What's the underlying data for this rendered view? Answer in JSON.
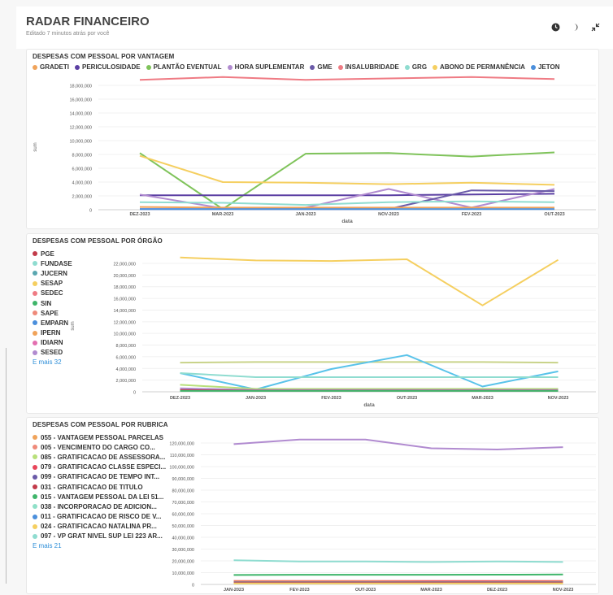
{
  "header": {
    "title": "RADAR FINANCEIRO",
    "subtitle": "Editado 7 minutos atrás por você",
    "icons": [
      "clock-icon",
      "moon-icon",
      "collapse-icon"
    ]
  },
  "charts": [
    {
      "title": "DESPESAS COM PESSOAL POR VANTAGEM",
      "more": "",
      "legend": [
        {
          "name": "GRADETI",
          "color": "#f0a35a"
        },
        {
          "name": "PERICULOSIDADE",
          "color": "#5b3fa3"
        },
        {
          "name": "PLANTÃO EVENTUAL",
          "color": "#7fc35a"
        },
        {
          "name": "HORA SUPLEMENTAR",
          "color": "#b18bd0"
        },
        {
          "name": "GME",
          "color": "#6a5aa8"
        },
        {
          "name": "INSALUBRIDADE",
          "color": "#ef7b84"
        },
        {
          "name": "GRG",
          "color": "#8fdcd0"
        },
        {
          "name": "ABONO DE PERMANÊNCIA",
          "color": "#f5cf60"
        },
        {
          "name": "JETON",
          "color": "#4b8fdc"
        }
      ],
      "chart_data": {
        "type": "line",
        "categories": [
          "DEZ-2023",
          "MAR-2023",
          "JAN-2023",
          "NOV-2023",
          "FEV-2023",
          "OUT-2023"
        ],
        "xlabel": "data",
        "ylabel": "sum",
        "ylim": [
          0,
          18000000
        ],
        "yticks": [
          "0",
          "2,000,000",
          "4,000,000",
          "6,000,000",
          "8,000,000",
          "10,000,000",
          "12,000,000",
          "14,000,000",
          "16,000,000",
          "18,000,000"
        ],
        "tick_step": 2000000,
        "series": [
          {
            "name": "INSALUBRIDADE",
            "color": "#ef7b84",
            "values": [
              18800000,
              19200000,
              18800000,
              19000000,
              19200000,
              18900000
            ]
          },
          {
            "name": "PLANTÃO EVENTUAL",
            "color": "#7fc35a",
            "values": [
              8200000,
              100000,
              8100000,
              8200000,
              7700000,
              8300000
            ]
          },
          {
            "name": "ABONO DE PERMANÊNCIA",
            "color": "#f5cf60",
            "values": [
              7800000,
              4000000,
              3900000,
              3700000,
              3900000,
              3600000
            ]
          },
          {
            "name": "PERICULOSIDADE",
            "color": "#5b3fa3",
            "values": [
              2100000,
              2100000,
              2100000,
              2100000,
              2200000,
              2300000
            ]
          },
          {
            "name": "HORA SUPLEMENTAR",
            "color": "#b18bd0",
            "values": [
              2200000,
              200000,
              300000,
              3000000,
              300000,
              3000000
            ]
          },
          {
            "name": "GME",
            "color": "#6a5aa8",
            "values": [
              100000,
              100000,
              100000,
              100000,
              2800000,
              2700000
            ]
          },
          {
            "name": "GRG",
            "color": "#8fdcd0",
            "values": [
              1100000,
              1000000,
              700000,
              1100000,
              1200000,
              1100000
            ]
          },
          {
            "name": "GRADETI",
            "color": "#f0a35a",
            "values": [
              400000,
              300000,
              300000,
              300000,
              300000,
              300000
            ]
          },
          {
            "name": "JETON",
            "color": "#4b8fdc",
            "values": [
              100000,
              100000,
              100000,
              100000,
              100000,
              100000
            ]
          }
        ]
      }
    },
    {
      "title": "DESPESAS COM PESSOAL POR ÓRGÃO",
      "more": "E mais 32",
      "legend": [
        {
          "name": "PGE",
          "color": "#c23b4a"
        },
        {
          "name": "FUNDASE",
          "color": "#8fdcd0"
        },
        {
          "name": "JUCERN",
          "color": "#5aa7b0"
        },
        {
          "name": "SESAP",
          "color": "#f5cf60"
        },
        {
          "name": "SEDEC",
          "color": "#ef7b84"
        },
        {
          "name": "SIN",
          "color": "#3fb56a"
        },
        {
          "name": "SAPE",
          "color": "#ef8a7a"
        },
        {
          "name": "EMPARN",
          "color": "#4b8fdc"
        },
        {
          "name": "IPERN",
          "color": "#f0a35a"
        },
        {
          "name": "IDIARN",
          "color": "#e36fb0"
        },
        {
          "name": "SESED",
          "color": "#b18bd0"
        }
      ],
      "chart_data": {
        "type": "line",
        "categories": [
          "DEZ-2023",
          "JAN-2023",
          "FEV-2023",
          "OUT-2023",
          "MAR-2023",
          "NOV-2023"
        ],
        "xlabel": "data",
        "ylabel": "sum",
        "ylim": [
          0,
          22000000
        ],
        "yticks": [
          "0",
          "2,000,000",
          "4,000,000",
          "6,000,000",
          "8,000,000",
          "10,000,000",
          "12,000,000",
          "14,000,000",
          "16,000,000",
          "18,000,000",
          "20,000,000",
          "22,000,000"
        ],
        "tick_step": 2000000,
        "series": [
          {
            "name": "SESAP",
            "color": "#f5cf60",
            "values": [
              23000000,
              22500000,
              22400000,
              22700000,
              14800000,
              22600000
            ]
          },
          {
            "name": "",
            "color": "#c9d38a",
            "values": [
              5000000,
              5100000,
              5100000,
              5100000,
              5100000,
              5000000
            ]
          },
          {
            "name": "",
            "color": "#59c3ea",
            "values": [
              3200000,
              400000,
              3900000,
              6300000,
              900000,
              3500000
            ]
          },
          {
            "name": "FUNDASE",
            "color": "#8fdcd0",
            "values": [
              3200000,
              2500000,
              2500000,
              2500000,
              2500000,
              2500000
            ]
          },
          {
            "name": "",
            "color": "#b8e07a",
            "values": [
              1200000,
              500000,
              500000,
              500000,
              500000,
              500000
            ]
          },
          {
            "name": "SESED",
            "color": "#b18bd0",
            "values": [
              600000,
              300000,
              300000,
              300000,
              300000,
              300000
            ]
          },
          {
            "name": "PGE",
            "color": "#c23b4a",
            "values": [
              300000,
              200000,
              200000,
              200000,
              200000,
              200000
            ]
          },
          {
            "name": "SIN",
            "color": "#3fb56a",
            "values": [
              150000,
              150000,
              150000,
              150000,
              150000,
              150000
            ]
          }
        ]
      }
    },
    {
      "title": "DESPESAS COM PESSOAL POR RUBRICA",
      "more": "E mais 21",
      "legend": [
        {
          "name": "055 - VANTAGEM PESSOAL PARCELAS",
          "color": "#f0a35a"
        },
        {
          "name": "005 - VENCIMENTO DO CARGO CO...",
          "color": "#ef8a7a"
        },
        {
          "name": "085 - GRATIFICACAO DE ASSESSORA...",
          "color": "#b8e07a"
        },
        {
          "name": "079 - GRATIFICACAO CLASSE ESPECI...",
          "color": "#e8455a"
        },
        {
          "name": "099 - GRATIFICACAO DE TEMPO INT...",
          "color": "#6a5aa8"
        },
        {
          "name": "031 - GRATIFICACAO DE TITULO",
          "color": "#c23b4a"
        },
        {
          "name": "015 - VANTAGEM PESSOAL DA LEI 51...",
          "color": "#3fb56a"
        },
        {
          "name": "038 - INCORPORACAO DE ADICION...",
          "color": "#8fe0c8"
        },
        {
          "name": "011 - GRATIFICACAO DE RISCO DE V...",
          "color": "#4b8fdc"
        },
        {
          "name": "024 - GRATIFICACAO NATALINA PR...",
          "color": "#f5cf60"
        },
        {
          "name": "097 - VP GRAT NIVEL SUP LEI 223 AR...",
          "color": "#8fdcd0"
        }
      ],
      "chart_data": {
        "type": "line",
        "categories": [
          "JAN-2023",
          "FEV-2023",
          "OUT-2023",
          "MAR-2023",
          "DEZ-2023",
          "NOV-2023"
        ],
        "xlabel": "",
        "ylabel": "",
        "ylim": [
          0,
          120000000
        ],
        "yticks": [
          "0",
          "10,000,000",
          "20,000,000",
          "30,000,000",
          "40,000,000",
          "50,000,000",
          "60,000,000",
          "70,000,000",
          "80,000,000",
          "90,000,000",
          "100,000,000",
          "110,000,000",
          "120,000,000"
        ],
        "tick_step": 10000000,
        "series": [
          {
            "name": "",
            "color": "#b18bd0",
            "values": [
              119000000,
              123000000,
              123000000,
              115500000,
              114500000,
              116500000
            ]
          },
          {
            "name": "097 - VP GRAT NIVEL SUP LEI 223 AR...",
            "color": "#8fdcd0",
            "values": [
              20500000,
              19500000,
              19500000,
              19000000,
              19500000,
              19000000
            ]
          },
          {
            "name": "015 - VANTAGEM PESSOAL DA LEI 51...",
            "color": "#3fb56a",
            "values": [
              8000000,
              8200000,
              8200000,
              8200000,
              8300000,
              8400000
            ]
          },
          {
            "name": "079 - GRATIFICACAO CLASSE ESPECI...",
            "color": "#e8455a",
            "values": [
              3000000,
              3000000,
              3000000,
              3000000,
              3000000,
              3000000
            ]
          },
          {
            "name": "055 - VANTAGEM PESSOAL PARCELAS",
            "color": "#f0a35a",
            "values": [
              2500000,
              2500000,
              2500000,
              2300000,
              2200000,
              2400000
            ]
          },
          {
            "name": "099 - GRATIFICACAO DE TEMPO INT...",
            "color": "#6a5aa8",
            "values": [
              1800000,
              1800000,
              1800000,
              1800000,
              1800000,
              1800000
            ]
          },
          {
            "name": "031 - GRATIFICACAO DE TITULO",
            "color": "#c23b4a",
            "values": [
              1200000,
              1200000,
              1200000,
              1200000,
              1200000,
              1200000
            ]
          },
          {
            "name": "024 - GRATIFICACAO NATALINA PR...",
            "color": "#f5cf60",
            "values": [
              800000,
              800000,
              800000,
              800000,
              800000,
              800000
            ]
          }
        ]
      }
    }
  ]
}
